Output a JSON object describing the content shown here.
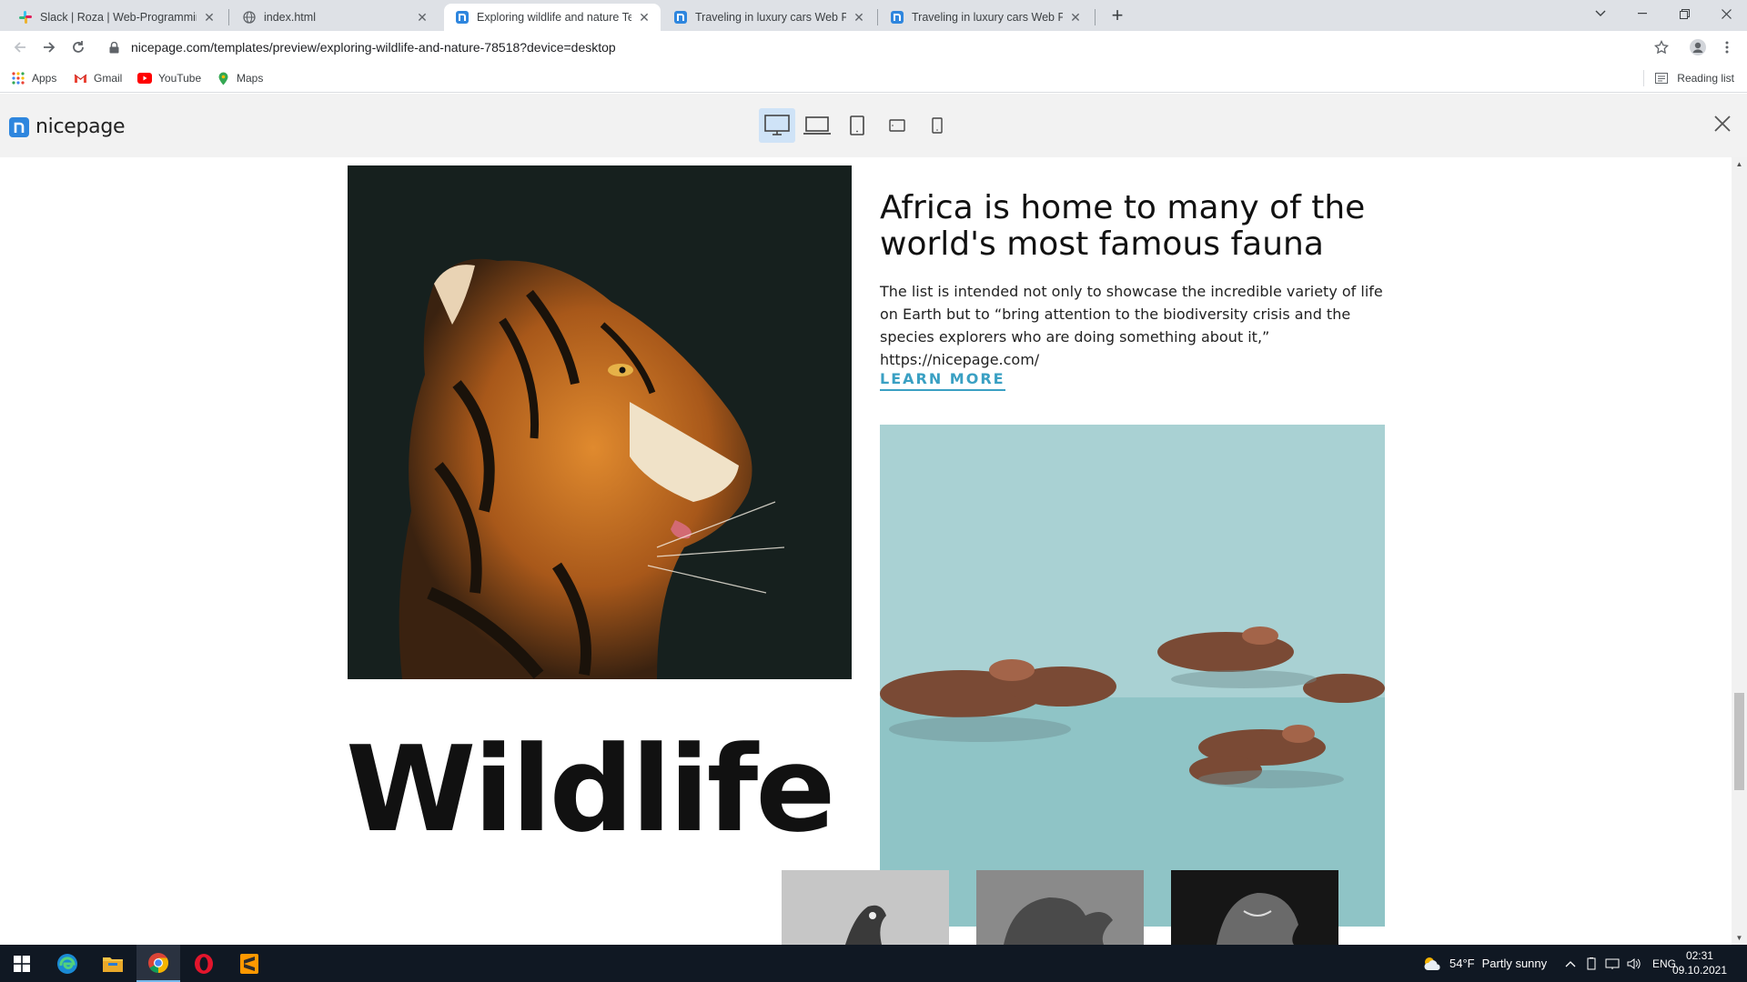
{
  "browser": {
    "tabs": [
      {
        "title": "Slack | Roza | Web-Programming",
        "active": false,
        "icon": "slack-icon"
      },
      {
        "title": "index.html",
        "active": false,
        "icon": "globe-icon"
      },
      {
        "title": "Exploring wildlife and nature Tem",
        "active": true,
        "icon": "nicepage-icon"
      },
      {
        "title": "Traveling in luxury cars Web Page",
        "active": false,
        "icon": "nicepage-icon"
      },
      {
        "title": "Traveling in luxury cars Web Page",
        "active": false,
        "icon": "nicepage-icon"
      }
    ],
    "url": "nicepage.com/templates/preview/exploring-wildlife-and-nature-78518?device=desktop",
    "bookmarks": [
      "Apps",
      "Gmail",
      "YouTube",
      "Maps"
    ],
    "reading_list": "Reading list"
  },
  "preview": {
    "logo_text": "nicepage",
    "devices": [
      "desktop-icon",
      "laptop-icon",
      "tablet-icon",
      "tablet-landscape-icon",
      "phone-icon"
    ],
    "active_device": "desktop"
  },
  "page": {
    "heading": "Africa is home to many of the world's most famous fauna",
    "paragraph": "The list is intended not only to showcase the incredible variety of life on Earth but to “bring attention to the biodiversity crisis and the species explorers who are doing something about it,” https://nicepage.com/",
    "cta": "LEARN MORE",
    "big_title": "Wildlife"
  },
  "taskbar": {
    "apps": [
      "windows-start-icon",
      "edge-icon",
      "file-explorer-icon",
      "chrome-icon",
      "opera-icon",
      "sublime-text-icon"
    ],
    "weather_temp": "54°F",
    "weather_desc": "Partly sunny",
    "language": "ENG",
    "time": "02:31",
    "date": "09.10.2021"
  },
  "colors": {
    "accent": "#3aa0c3",
    "nicepage_blue": "#2e86de",
    "taskbar": "#101823"
  }
}
